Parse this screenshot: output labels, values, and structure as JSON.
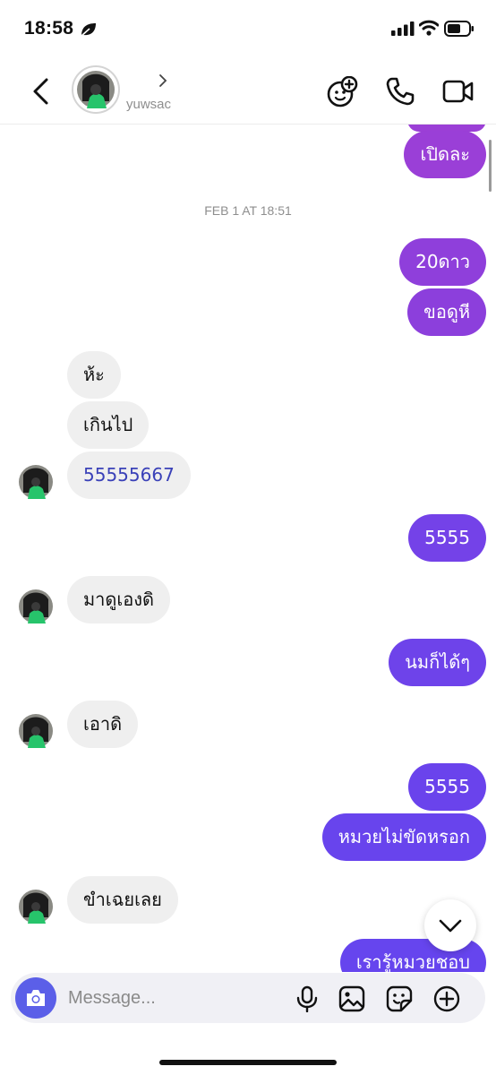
{
  "status_bar": {
    "time": "18:58"
  },
  "header": {
    "username": "yuwsac"
  },
  "chat": {
    "timestamp": "FEB 1 AT 18:51",
    "messages": [
      {
        "side": "out",
        "text": "เปิดละ"
      },
      {
        "side": "out",
        "text": "20ดาว"
      },
      {
        "side": "out",
        "text": "ขอดูหี"
      },
      {
        "side": "in",
        "text": "ห้ะ"
      },
      {
        "side": "in",
        "text": "เกินไป"
      },
      {
        "side": "in",
        "text": "55555667"
      },
      {
        "side": "out",
        "text": "5555"
      },
      {
        "side": "in",
        "text": "มาดูเองดิ"
      },
      {
        "side": "out",
        "text": "นมก็ได้ๆ"
      },
      {
        "side": "in",
        "text": "เอาดิ"
      },
      {
        "side": "out",
        "text": "5555"
      },
      {
        "side": "out",
        "text": "หมวยไม่ขัดหรอก"
      },
      {
        "side": "in",
        "text": "ขำเฉยเลย"
      },
      {
        "side": "out",
        "text": "เรารู้หมวยชอบ"
      }
    ]
  },
  "composer": {
    "placeholder": "Message..."
  },
  "colors": {
    "outgoing_top": "#9b3fd6",
    "outgoing_bottom": "#6a43ec",
    "incoming": "#efefef",
    "accent": "#5b5fe8"
  },
  "icons": [
    "back-chevron-icon",
    "emoji-group-icon",
    "phone-icon",
    "video-camera-icon",
    "camera-icon",
    "microphone-icon",
    "gallery-icon",
    "sticker-icon",
    "plus-icon",
    "chevron-down-icon"
  ]
}
